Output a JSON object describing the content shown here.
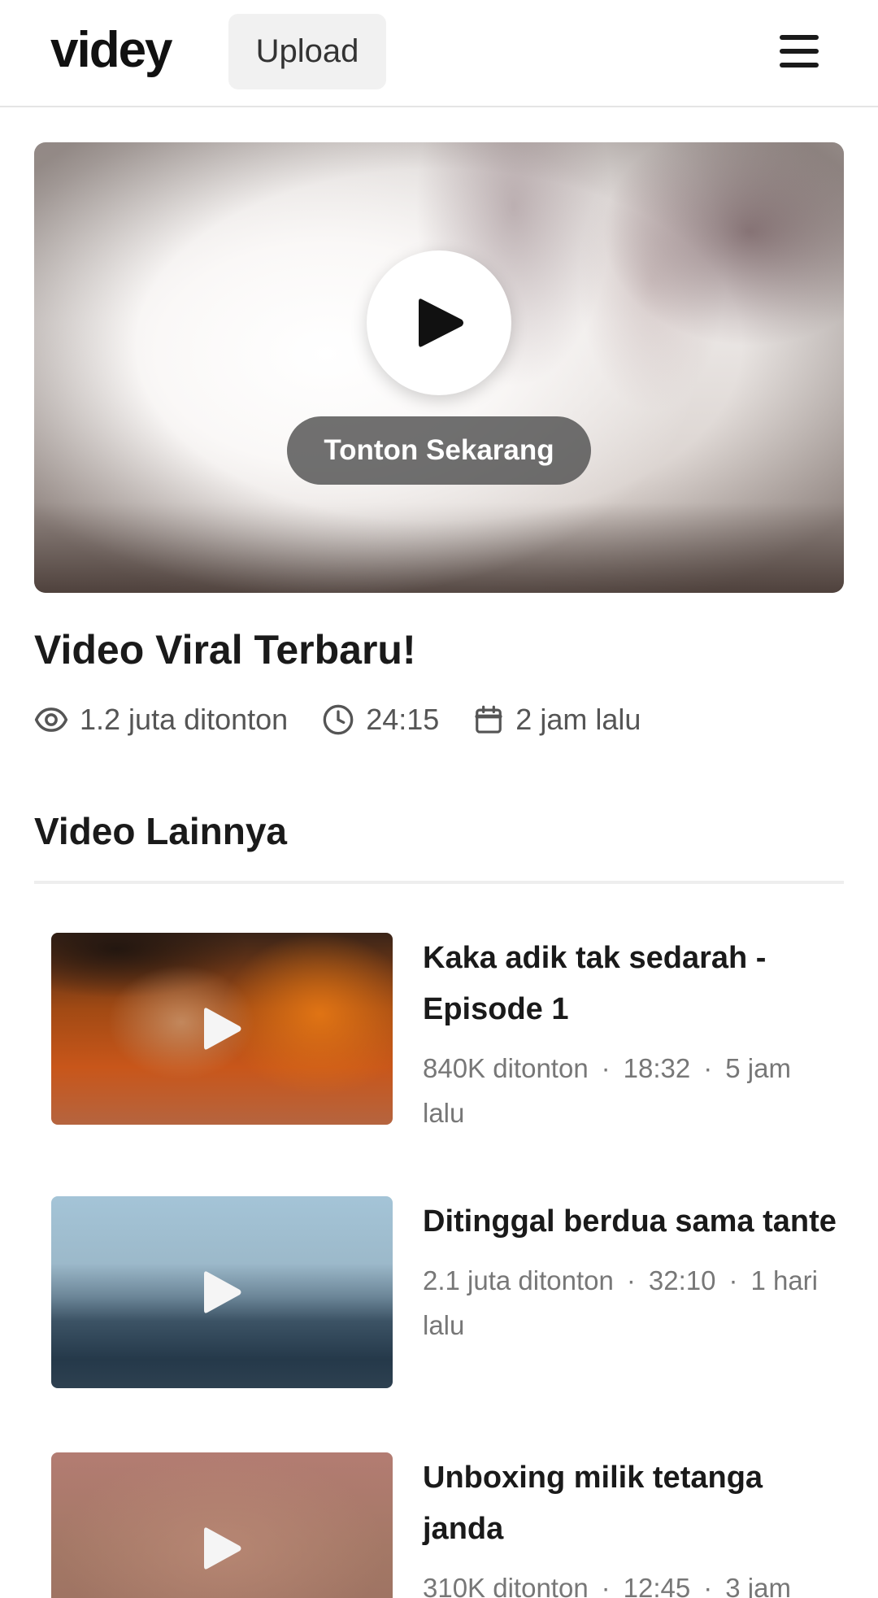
{
  "header": {
    "logo": "videy",
    "upload_label": "Upload"
  },
  "hero": {
    "watch_label": "Tonton Sekarang",
    "title": "Video Viral Terbaru!",
    "views": "1.2 juta ditonton",
    "duration": "24:15",
    "date": "2 jam lalu"
  },
  "section": {
    "title": "Video Lainnya"
  },
  "videos": [
    {
      "title": "Kaka adik tak sedarah - Episode 1",
      "views": "840K ditonton",
      "duration": "18:32",
      "date": "5 jam lalu"
    },
    {
      "title": "Ditinggal berdua sama tante",
      "views": "2.1 juta ditonton",
      "duration": "32:10",
      "date": "1 hari lalu"
    },
    {
      "title": "Unboxing milik tetanga janda",
      "views": "310K ditonton",
      "duration": "12:45",
      "date": "3 jam"
    }
  ],
  "separator": "·",
  "icons": {
    "menu": "hamburger-menu-icon",
    "play": "play-icon",
    "views": "eye-icon",
    "duration": "clock-icon",
    "date": "calendar-icon"
  }
}
